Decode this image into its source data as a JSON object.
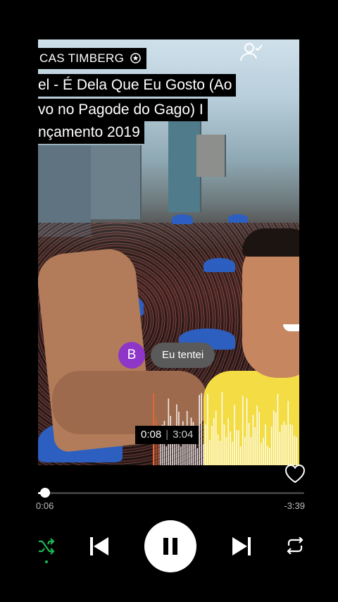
{
  "video": {
    "artist_label": "CAS TIMBERG",
    "title_lines": [
      "el - É Dela Que Eu Gosto (Ao",
      "vo no Pagode do Gago) I",
      "nçamento 2019"
    ]
  },
  "comment": {
    "avatar_letter": "B",
    "avatar_color": "#8e36c8",
    "text": "Eu tentei"
  },
  "preview": {
    "elapsed": "0:08",
    "duration": "3:04",
    "progress_fraction": 0.043
  },
  "player": {
    "elapsed": "0:06",
    "remaining": "-3:39",
    "progress_fraction": 0.027,
    "shuffle_active": true,
    "accent_color": "#1db954",
    "state": "playing"
  }
}
